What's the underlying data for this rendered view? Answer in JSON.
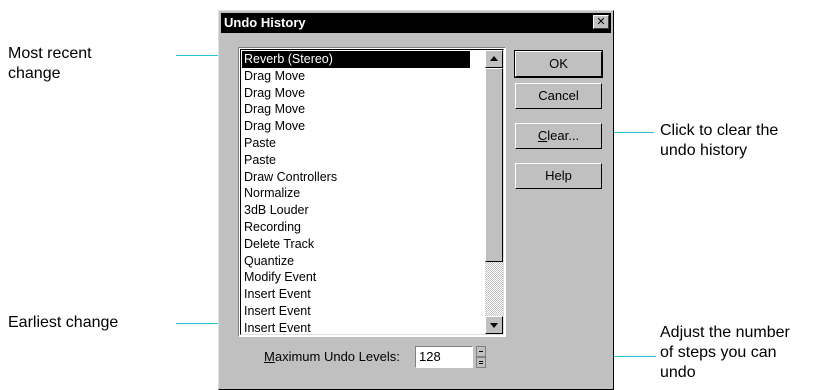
{
  "callouts": {
    "most_recent": "Most recent\nchange",
    "earliest": "Earliest change",
    "clear_hint": "Click to clear the\nundo history",
    "adjust_hint": "Adjust the number\nof steps you can\nundo"
  },
  "dialog": {
    "title": "Undo History",
    "close_glyph": "✕",
    "history_items": [
      "Reverb (Stereo)",
      "Drag Move",
      "Drag Move",
      "Drag Move",
      "Drag Move",
      "Paste",
      "Paste",
      "Draw Controllers",
      "Normalize",
      "3dB Louder",
      "Recording",
      "Delete Track",
      "Quantize",
      "Modify Event",
      "Insert Event",
      "Insert Event",
      "Insert Event"
    ],
    "selected_index": 0,
    "buttons": {
      "ok": "OK",
      "cancel": "Cancel",
      "clear_underlined": "C",
      "clear_rest": "lear...",
      "help": "Help"
    },
    "max_levels": {
      "label_underlined": "M",
      "label_rest": "aximum Undo Levels:",
      "value": "128"
    }
  },
  "colors": {
    "leader_line": "#29c3d8",
    "dialog_face": "#c0c0c0",
    "titlebar": "#000000"
  }
}
